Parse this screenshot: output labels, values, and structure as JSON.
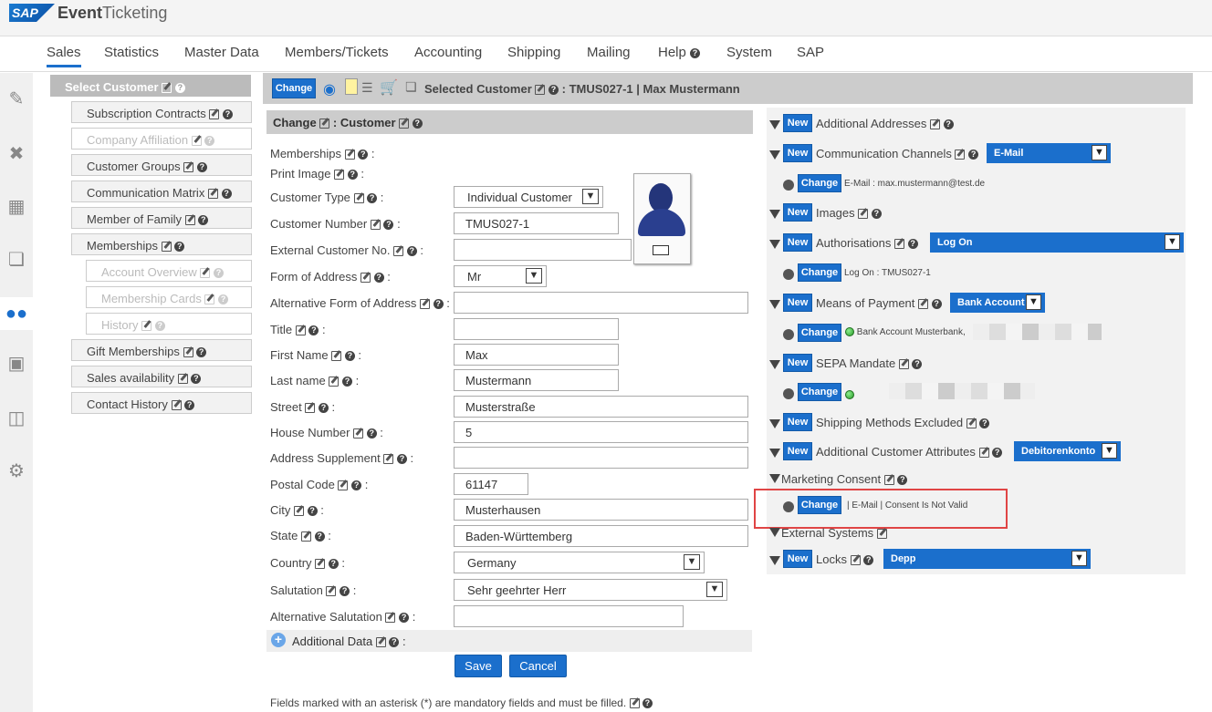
{
  "app": {
    "logo": "SAP",
    "title_part1": "Event",
    "title_part2": "Ticketing"
  },
  "nav": [
    "Sales",
    "Statistics",
    "Master Data",
    "Members/Tickets",
    "Accounting",
    "Shipping",
    "Mailing",
    "Help",
    "System",
    "SAP"
  ],
  "left_nav": {
    "header": "Select Customer",
    "items": [
      "Subscription Contracts",
      "Company Affiliation",
      "Customer Groups",
      "Communication Matrix",
      "Member of Family",
      "Memberships",
      "Account Overview",
      "Membership Cards",
      "History",
      "Gift Memberships",
      "Sales availability",
      "Contact History"
    ]
  },
  "toolbar": {
    "change_label": "Change",
    "selected_label": "Selected Customer",
    "selected_value": ": TMUS027-1 | Max Mustermann"
  },
  "form": {
    "header_change": "Change",
    "header_customer": ": Customer",
    "labels": {
      "memberships": "Memberships",
      "print_image": "Print Image",
      "customer_type": "Customer Type",
      "customer_number": "Customer Number",
      "external_customer_no": "External Customer No.",
      "form_of_address": "Form of Address",
      "alt_form_of_address": "Alternative Form of Address",
      "title": "Title",
      "first_name": "First Name",
      "last_name": "Last name",
      "street": "Street",
      "house_number": "House Number",
      "address_supplement": "Address Supplement",
      "postal_code": "Postal Code",
      "city": "City",
      "state": "State",
      "country": "Country",
      "salutation": "Salutation",
      "alt_salutation": "Alternative Salutation",
      "additional_data": "Additional Data"
    },
    "values": {
      "customer_type": "Individual Customer",
      "customer_number": "TMUS027-1",
      "external_customer_no": "",
      "form_of_address": "Mr",
      "alt_form_of_address": "",
      "title": "",
      "first_name": "Max",
      "last_name": "Mustermann",
      "street": "Musterstraße",
      "house_number": "5",
      "address_supplement": "",
      "postal_code": "61147",
      "city": "Musterhausen",
      "state": "Baden-Württemberg",
      "country": "Germany",
      "salutation": "Sehr geehrter Herr",
      "alt_salutation": ""
    },
    "save_label": "Save",
    "cancel_label": "Cancel",
    "footnote": "Fields marked with an asterisk (*) are mandatory fields and must be filled."
  },
  "right": {
    "new_label": "New",
    "change_label": "Change",
    "additional_addresses": "Additional Addresses",
    "communication_channels": "Communication Channels",
    "comm_select": "E-Mail",
    "comm_detail": "E-Mail : max.mustermann@test.de",
    "images": "Images",
    "authorisations": "Authorisations",
    "auth_select": "Log On",
    "auth_detail": "Log On : TMUS027-1",
    "means_of_payment": "Means of Payment",
    "payment_select": "Bank Account",
    "payment_detail": "Bank Account Musterbank,",
    "sepa_mandate": "SEPA Mandate",
    "shipping_methods_excluded": "Shipping Methods Excluded",
    "additional_customer_attributes": "Additional Customer Attributes",
    "attr_select": "Debitorenkonto",
    "marketing_consent": "Marketing Consent",
    "consent_detail": "| E-Mail | Consent Is Not Valid",
    "external_systems": "External Systems",
    "locks": "Locks",
    "locks_select": "Depp"
  }
}
